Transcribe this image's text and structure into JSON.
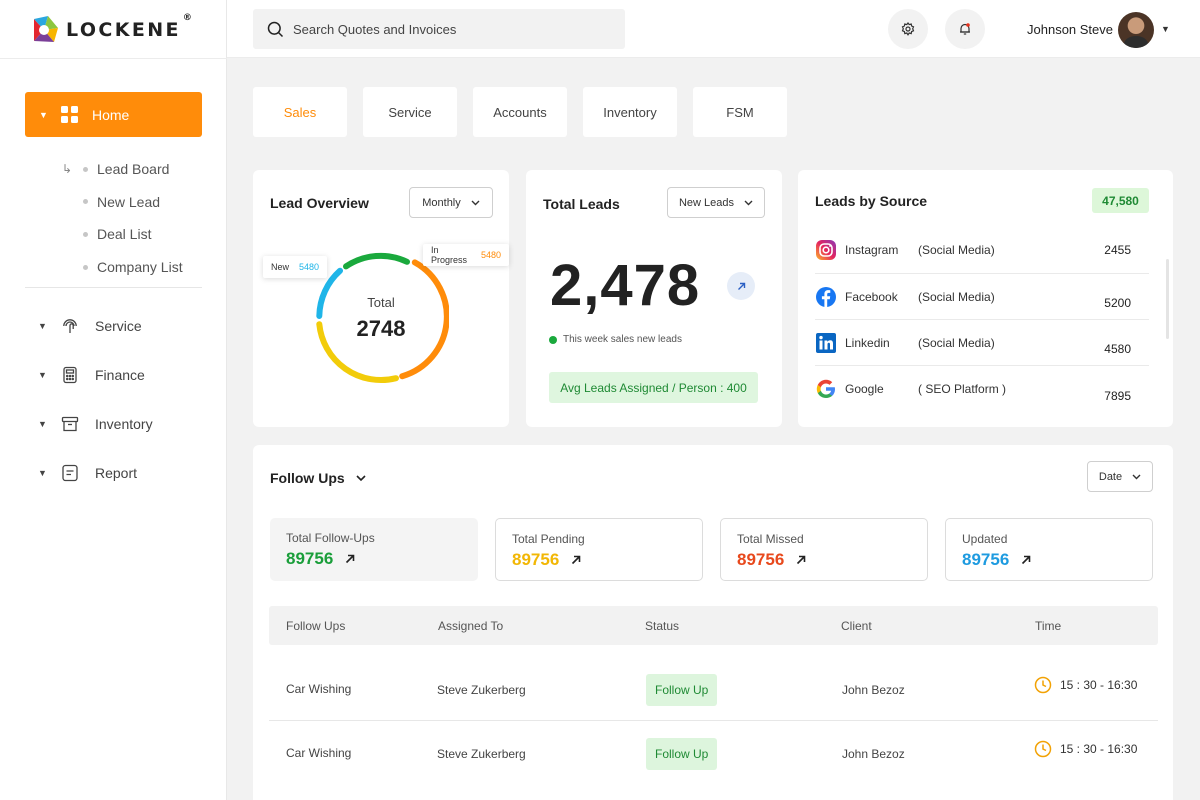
{
  "app": {
    "brand": "LOCKENE",
    "brand_mark": "®"
  },
  "sidebar": {
    "home": {
      "label": "Home",
      "sub_items": [
        "Lead Board",
        "New Lead",
        "Deal List",
        "Company List"
      ]
    },
    "items": [
      {
        "label": "Service",
        "icon": "touch-icon"
      },
      {
        "label": "Finance",
        "icon": "calculator-icon"
      },
      {
        "label": "Inventory",
        "icon": "archive-box-icon"
      },
      {
        "label": "Report",
        "icon": "document-icon"
      }
    ]
  },
  "topbar": {
    "search_placeholder": "Search Quotes and Invoices",
    "user_name": "Johnson Steve"
  },
  "tabs": [
    {
      "label": "Sales",
      "active": true
    },
    {
      "label": "Service",
      "active": false
    },
    {
      "label": "Accounts",
      "active": false
    },
    {
      "label": "Inventory",
      "active": false
    },
    {
      "label": "FSM",
      "active": false
    }
  ],
  "lead_overview": {
    "title": "Lead Overview",
    "period": "Monthly",
    "total_label": "Total",
    "total_value": "2748",
    "new_label": "New",
    "new_value": "5480",
    "progress_label": "In Progress",
    "progress_value": "5480"
  },
  "total_leads": {
    "title": "Total Leads",
    "filter": "New Leads",
    "value": "2,478",
    "note": "This week sales new leads",
    "avg": "Avg Leads Assigned / Person : 400"
  },
  "leads_by_source": {
    "title": "Leads by Source",
    "total": "47,580",
    "rows": [
      {
        "name": "Instagram",
        "type": "(Social Media)",
        "value": "2455"
      },
      {
        "name": "Facebook",
        "type": "(Social Media)",
        "value": "5200"
      },
      {
        "name": "Linkedin",
        "type": "(Social Media)",
        "value": "4580"
      },
      {
        "name": "Google",
        "type": "( SEO Platform )",
        "value": "7895"
      }
    ]
  },
  "follow_ups": {
    "title": "Follow Ups",
    "filter": "Date",
    "stats": [
      {
        "label": "Total Follow-Ups",
        "value": "89756",
        "color": "#1a9e3a"
      },
      {
        "label": "Total Pending",
        "value": "89756",
        "color": "#f2b705"
      },
      {
        "label": "Total Missed",
        "value": "89756",
        "color": "#e8491d"
      },
      {
        "label": "Updated",
        "value": "89756",
        "color": "#1e9be0"
      }
    ],
    "columns": [
      "Follow Ups",
      "Assigned To",
      "Status",
      "Client",
      "Time"
    ],
    "rows": [
      {
        "follow_up": "Car Wishing",
        "assigned": "Steve Zukerberg",
        "status": "Follow Up",
        "client": "John Bezoz",
        "time": "15 : 30 - 16:30"
      },
      {
        "follow_up": "Car Wishing",
        "assigned": "Steve Zukerberg",
        "status": "Follow Up",
        "client": "John Bezoz",
        "time": "15 : 30 - 16:30"
      }
    ]
  },
  "colors": {
    "accent": "#ff8c0a",
    "green": "#1a9e3a",
    "blue": "#1fb5e8",
    "yellow": "#f2b705"
  }
}
